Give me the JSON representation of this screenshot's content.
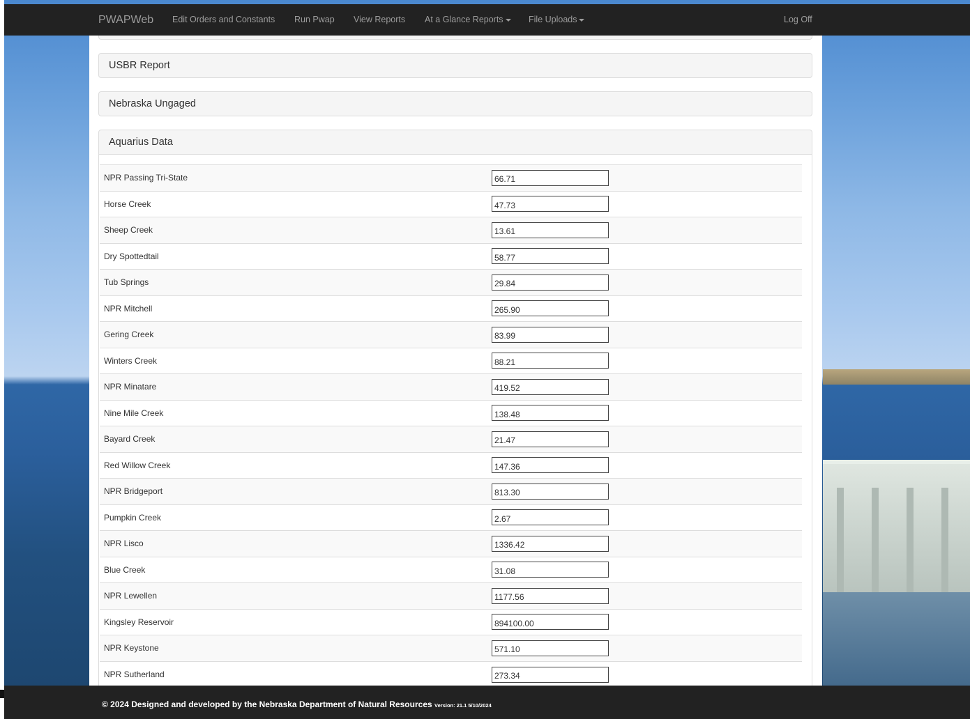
{
  "navbar": {
    "brand": "PWAPWeb",
    "items": [
      {
        "label": "Edit Orders and Constants",
        "dropdown": false
      },
      {
        "label": "Run Pwap",
        "dropdown": false
      },
      {
        "label": "View Reports",
        "dropdown": false
      },
      {
        "label": "At a Glance Reports",
        "dropdown": true
      },
      {
        "label": "File Uploads",
        "dropdown": true
      }
    ],
    "logoff": "Log Off"
  },
  "panels": {
    "usbr": "USBR Report",
    "nebraska": "Nebraska Ungaged",
    "aquarius": "Aquarius Data"
  },
  "aquarius_rows": [
    {
      "label": "NPR Passing Tri-State",
      "value": "66.71"
    },
    {
      "label": "Horse Creek",
      "value": "47.73"
    },
    {
      "label": "Sheep Creek",
      "value": "13.61"
    },
    {
      "label": "Dry Spottedtail",
      "value": "58.77"
    },
    {
      "label": "Tub Springs",
      "value": "29.84"
    },
    {
      "label": "NPR Mitchell",
      "value": "265.90"
    },
    {
      "label": "Gering Creek",
      "value": "83.99"
    },
    {
      "label": "Winters Creek",
      "value": "88.21"
    },
    {
      "label": "NPR Minatare",
      "value": "419.52"
    },
    {
      "label": "Nine Mile Creek",
      "value": "138.48"
    },
    {
      "label": "Bayard Creek",
      "value": "21.47"
    },
    {
      "label": "Red Willow Creek",
      "value": "147.36"
    },
    {
      "label": "NPR Bridgeport",
      "value": "813.30"
    },
    {
      "label": "Pumpkin Creek",
      "value": "2.67"
    },
    {
      "label": "NPR Lisco",
      "value": "1336.42"
    },
    {
      "label": "Blue Creek",
      "value": "31.08"
    },
    {
      "label": "NPR Lewellen",
      "value": "1177.56"
    },
    {
      "label": "Kingsley Reservoir",
      "value": "894100.00"
    },
    {
      "label": "NPR Keystone",
      "value": "571.10"
    },
    {
      "label": "NPR Sutherland",
      "value": "273.34"
    }
  ],
  "footer": {
    "text": "© 2024 Designed and developed by the Nebraska Department of Natural Resources",
    "version": "Version: 21.1 5/10/2024"
  }
}
